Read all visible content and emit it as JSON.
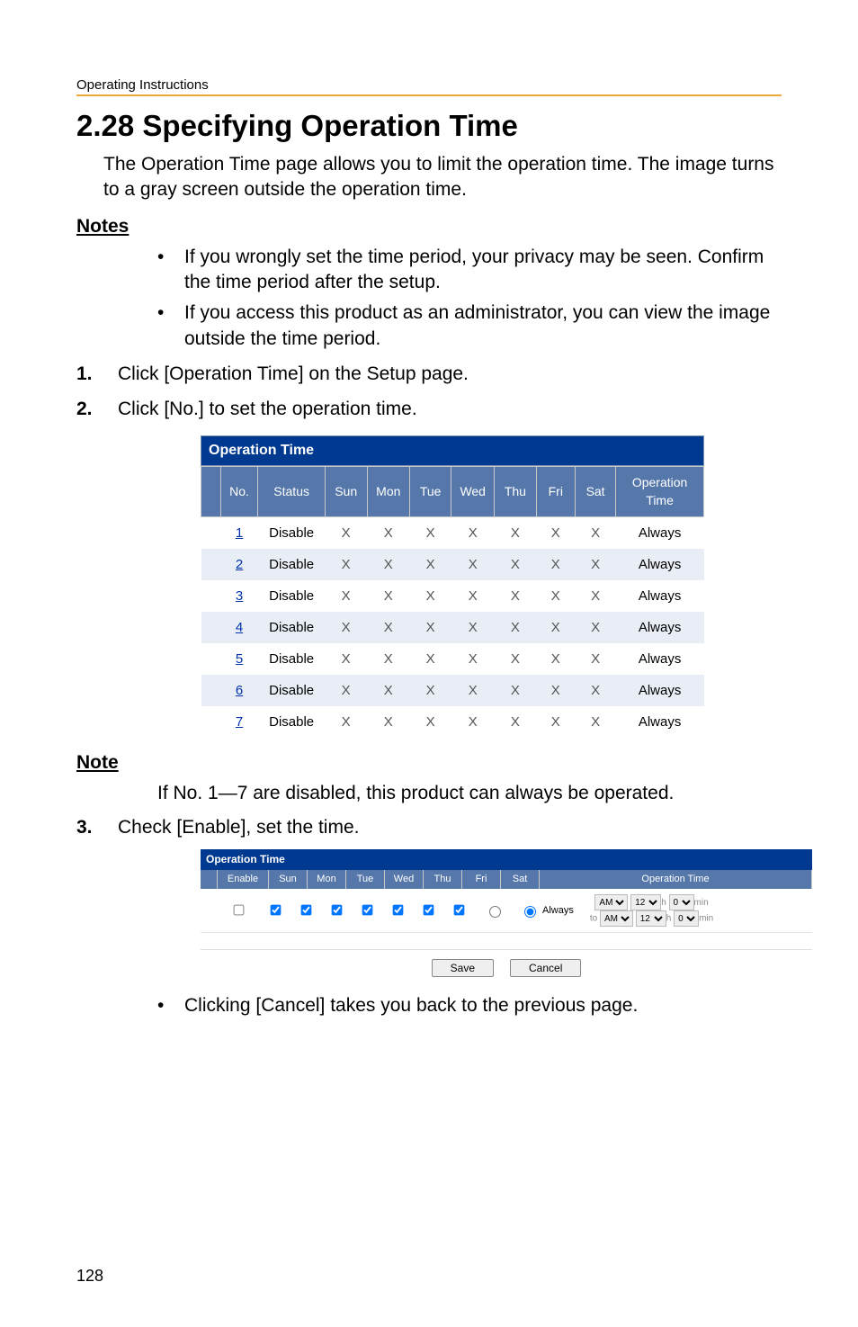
{
  "header": {
    "running_head": "Operating Instructions"
  },
  "title": "2.28  Specifying Operation Time",
  "intro": "The Operation Time page allows you to limit the operation time. The image turns to a gray screen outside the operation time.",
  "notes_heading": "Notes",
  "notes": [
    "If you wrongly set the time period, your privacy may be seen. Confirm the time period after the setup.",
    "If you access this product as an administrator, you can view the image outside the time period."
  ],
  "steps": {
    "s1": "Click [Operation Time] on the Setup page.",
    "s2": "Click [No.] to set the operation time.",
    "s3": "Check [Enable], set the time."
  },
  "op_table": {
    "caption": "Operation Time",
    "headers": {
      "no": "No.",
      "status": "Status",
      "sun": "Sun",
      "mon": "Mon",
      "tue": "Tue",
      "wed": "Wed",
      "thu": "Thu",
      "fri": "Fri",
      "sat": "Sat",
      "optime": "Operation Time"
    },
    "rows": [
      {
        "no": "1",
        "status": "Disable",
        "cells": [
          "X",
          "X",
          "X",
          "X",
          "X",
          "X",
          "X"
        ],
        "optime": "Always"
      },
      {
        "no": "2",
        "status": "Disable",
        "cells": [
          "X",
          "X",
          "X",
          "X",
          "X",
          "X",
          "X"
        ],
        "optime": "Always"
      },
      {
        "no": "3",
        "status": "Disable",
        "cells": [
          "X",
          "X",
          "X",
          "X",
          "X",
          "X",
          "X"
        ],
        "optime": "Always"
      },
      {
        "no": "4",
        "status": "Disable",
        "cells": [
          "X",
          "X",
          "X",
          "X",
          "X",
          "X",
          "X"
        ],
        "optime": "Always"
      },
      {
        "no": "5",
        "status": "Disable",
        "cells": [
          "X",
          "X",
          "X",
          "X",
          "X",
          "X",
          "X"
        ],
        "optime": "Always"
      },
      {
        "no": "6",
        "status": "Disable",
        "cells": [
          "X",
          "X",
          "X",
          "X",
          "X",
          "X",
          "X"
        ],
        "optime": "Always"
      },
      {
        "no": "7",
        "status": "Disable",
        "cells": [
          "X",
          "X",
          "X",
          "X",
          "X",
          "X",
          "X"
        ],
        "optime": "Always"
      }
    ]
  },
  "note_heading": "Note",
  "note_body": "If No. 1—7 are disabled, this product can always be operated.",
  "cfg": {
    "caption": "Operation Time",
    "headers": {
      "enable": "Enable",
      "sun": "Sun",
      "mon": "Mon",
      "tue": "Tue",
      "wed": "Wed",
      "thu": "Thu",
      "fri": "Fri",
      "sat": "Sat",
      "optime": "Operation Time"
    },
    "always_label": "Always",
    "time": {
      "am": "AM",
      "hour": "12",
      "hlabel": "h",
      "min": "0",
      "minlabel": "min",
      "to": "to"
    },
    "save": "Save",
    "cancel": "Cancel"
  },
  "after_fig_bullet": "Clicking [Cancel] takes you back to the previous page.",
  "page_number": "128"
}
